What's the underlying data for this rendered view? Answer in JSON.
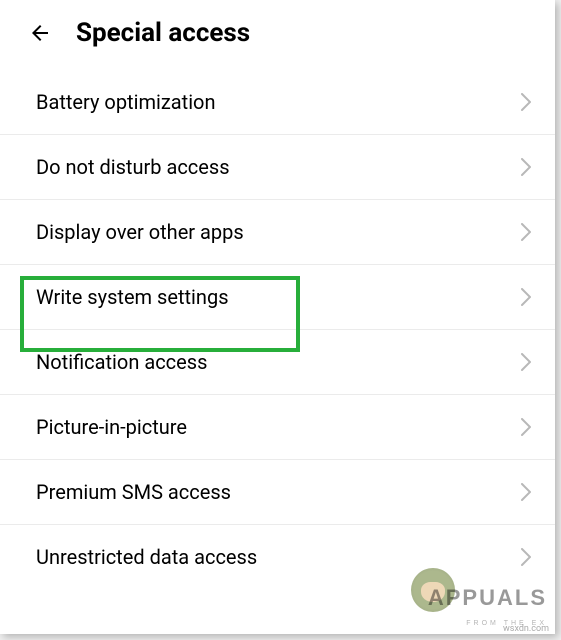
{
  "header": {
    "title": "Special access"
  },
  "items": [
    {
      "label": "Battery optimization"
    },
    {
      "label": "Do not disturb access"
    },
    {
      "label": "Display over other apps"
    },
    {
      "label": "Write system settings"
    },
    {
      "label": "Notification access"
    },
    {
      "label": "Picture-in-picture"
    },
    {
      "label": "Premium SMS access"
    },
    {
      "label": "Unrestricted data access"
    }
  ],
  "watermark": {
    "brand": "APPUALS",
    "tagline": "FROM THE EX",
    "source": "wsxdn.com"
  }
}
